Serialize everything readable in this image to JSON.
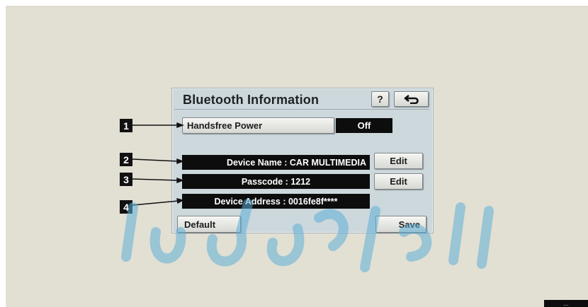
{
  "screen": {
    "title": "Bluetooth Information",
    "help_label": "?",
    "back_icon": "back-arrow-icon"
  },
  "handsfree": {
    "label": "Handsfree Power",
    "value": "Off"
  },
  "device": {
    "name": "Device Name : CAR MULTIMEDIA",
    "passcode": "Passcode : 1212",
    "address": "Device Address : 0016fe8f****"
  },
  "buttons": {
    "edit_name": "Edit",
    "edit_passcode": "Edit",
    "default": "Default",
    "save": "Save"
  },
  "callouts": [
    "1",
    "2",
    "3",
    "4"
  ],
  "corner_tag": "...",
  "colors": {
    "page_bg": "#e2dfd3",
    "panel_bg": "#ccd8dc",
    "bar_bg": "#0d0d0d",
    "watermark": "#5fb0d8"
  }
}
